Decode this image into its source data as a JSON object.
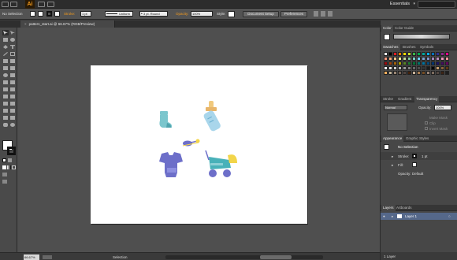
{
  "app": {
    "logo": "Ai",
    "workspace": "Essentials"
  },
  "control_bar": {
    "selection_label": "No Selection",
    "stroke_label": "Stroke:",
    "stroke_weight": "1 pt",
    "profile": "Uniform",
    "brush": "3 pt. Round",
    "opacity_label": "Opacity:",
    "opacity": "100%",
    "style_label": "Style:",
    "document_setup": "Document Setup",
    "preferences": "Preferences"
  },
  "document": {
    "tab_title": "pattern_start.ai @ 66.67% (RGB/Preview)",
    "close": "×"
  },
  "status": {
    "zoom": "66.67%",
    "mode": "Selection"
  },
  "panels": {
    "color": {
      "tabs": [
        "Color",
        "Color Guide"
      ]
    },
    "swatches": {
      "tabs": [
        "Swatches",
        "Brushes",
        "Symbols"
      ],
      "colors": [
        "#ffffff",
        "#000000",
        "#ed1c24",
        "#ff7f00",
        "#ffde00",
        "#c7e02f",
        "#39b54a",
        "#00a651",
        "#00a99d",
        "#00aeef",
        "#0072bc",
        "#2e3192",
        "#92278f",
        "#ec008c",
        "#f7977a",
        "#f9ad81",
        "#fdc68a",
        "#fff79a",
        "#c4df9b",
        "#82ca9d",
        "#7bcdc8",
        "#6ecff6",
        "#7ea7d8",
        "#8493ca",
        "#a187be",
        "#bc8dbf",
        "#f49ac2",
        "#f6989d",
        "#9e0b0f",
        "#a0410d",
        "#a36209",
        "#aba000",
        "#598527",
        "#1a7b30",
        "#007236",
        "#00746b",
        "#0076a3",
        "#004b80",
        "#003471",
        "#1b1464",
        "#440e62",
        "#630460",
        "#ffffff",
        "#e6e6e6",
        "#cccccc",
        "#b3b3b3",
        "#999999",
        "#808080",
        "#666666",
        "#4d4d4d",
        "#333333",
        "#1a1a1a",
        "#000000",
        "#c69c6d",
        "#8c6239",
        "#603913",
        "#fbaf5d",
        "#c2b59b",
        "#998675",
        "#736357",
        "#534741",
        "#42210b",
        "#c7b299",
        "#a67c52",
        "#754c24",
        "#9a8478",
        "#7d6c5e",
        "#534741",
        "#3c2415",
        "#1e1e1e"
      ]
    },
    "transparency": {
      "tabs": [
        "Stroke",
        "Gradient",
        "Transparency"
      ],
      "blend_mode": "Normal",
      "opacity_label": "Opacity:",
      "opacity": "100%",
      "make_mask": "Make Mask",
      "clip": "Clip",
      "invert_mask": "Invert Mask"
    },
    "appearance": {
      "tabs": [
        "Appearance",
        "Graphic Styles"
      ],
      "selection": "No Selection",
      "stroke_label": "Stroke:",
      "stroke_value": "1 pt",
      "fill_label": "Fill:",
      "opacity_label": "Opacity:",
      "opacity_value": "Default"
    },
    "layers": {
      "tabs": [
        "Layers",
        "Artboards"
      ],
      "layer_name": "Layer 1",
      "footer": "1 Layer"
    }
  }
}
